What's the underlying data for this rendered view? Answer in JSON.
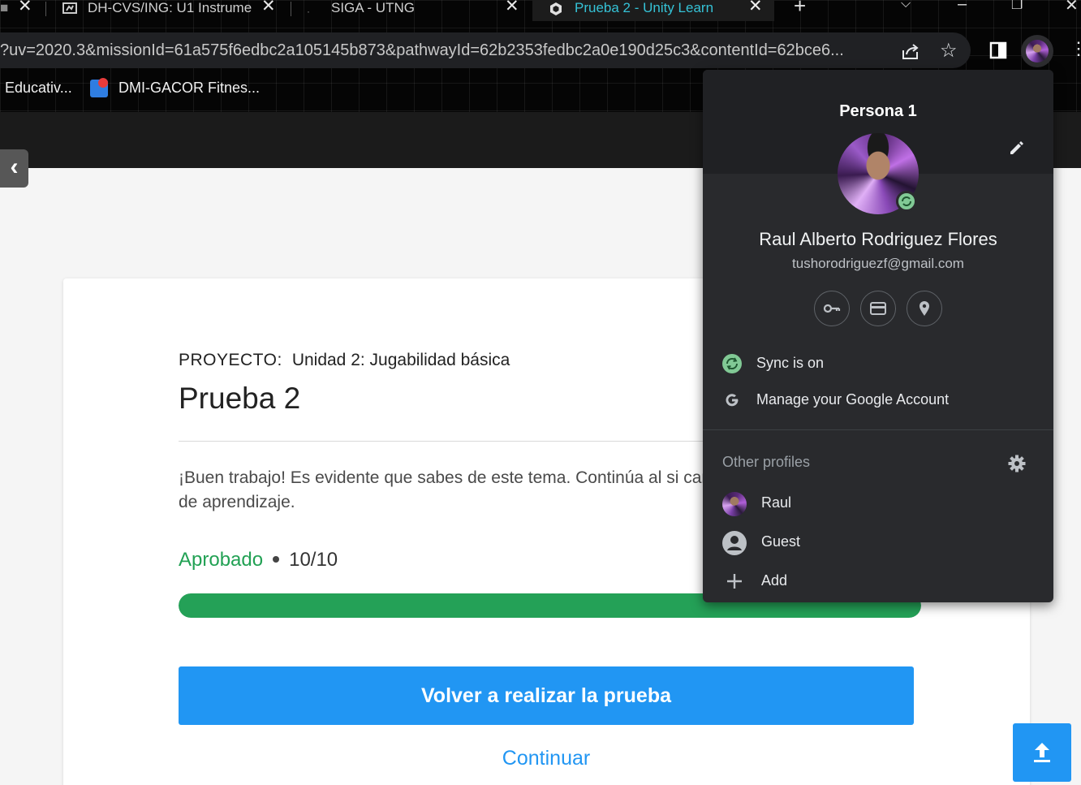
{
  "browser": {
    "tabs": [
      {
        "title": "",
        "active": false
      },
      {
        "title": "DH-CVS/ING: U1 Instrume",
        "active": false
      },
      {
        "title": "SIGA - UTNG",
        "active": false
      },
      {
        "title": "Prueba 2 - Unity Learn",
        "active": true
      }
    ],
    "new_tab": "+",
    "url": "?uv=2020.3&missionId=61a575f6edbc2a105145b873&pathwayId=62b2353fedbc2a0e190d25c3&contentId=62bce6...",
    "bookmarks": [
      "Educativ...",
      "DMI-GACOR Fitnes..."
    ]
  },
  "page": {
    "project_label": "PROYECTO:",
    "project_name": "Unidad 2: Jugabilidad básica",
    "title": "Prueba 2",
    "description": "¡Buen trabajo! Es evidente que sabes de este tema. Continúa al si camino de aprendizaje.",
    "status": "Aprobado",
    "score": "10/10",
    "progress_percent": 100,
    "retry_label": "Volver a realizar la prueba",
    "continue_label": "Continuar"
  },
  "profile_menu": {
    "profile_title": "Persona 1",
    "user_name": "Raul Alberto Rodriguez Flores",
    "email": "tushorodriguezf@gmail.com",
    "quick_buttons": [
      "key-icon",
      "credit-card-icon",
      "location-pin-icon"
    ],
    "sync_label": "Sync is on",
    "manage_label": "Manage your Google Account",
    "other_profiles_label": "Other profiles",
    "profiles": [
      {
        "name": "Raul",
        "icon": "avatar"
      },
      {
        "name": "Guest",
        "icon": "guest-icon"
      },
      {
        "name": "Add",
        "icon": "plus-icon"
      }
    ]
  },
  "colors": {
    "accent_blue": "#2196f3",
    "pass_green": "#22a154",
    "sync_green": "#81c995",
    "popup_bg": "#292a2d",
    "active_tab_text": "#35c2d6"
  }
}
